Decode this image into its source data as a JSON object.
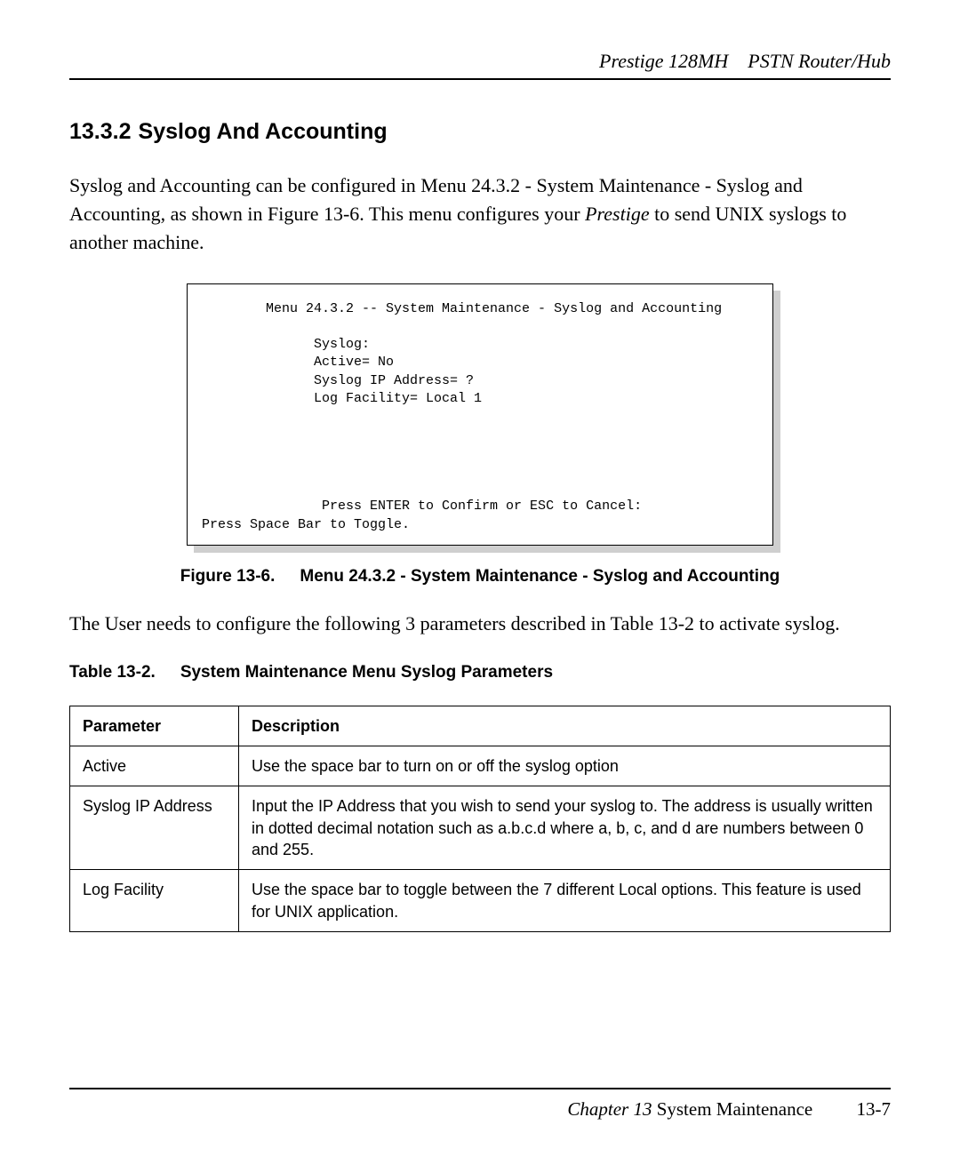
{
  "header": {
    "product": "Prestige 128MH",
    "subtitle": "PSTN Router/Hub"
  },
  "section": {
    "number": "13.3.2",
    "title": "Syslog And Accounting"
  },
  "intro": {
    "p1_prefix": "Syslog and Accounting can be configured in Menu 24.3.2 - System Maintenance - Syslog and Accounting, as shown in Figure 13-6. This menu configures your ",
    "p1_em": "Prestige",
    "p1_suffix": " to send UNIX syslogs to another machine."
  },
  "figure": {
    "box_text": "        Menu 24.3.2 -- System Maintenance - Syslog and Accounting\n\n              Syslog:\n              Active= No\n              Syslog IP Address= ?\n              Log Facility= Local 1\n\n\n\n\n\n               Press ENTER to Confirm or ESC to Cancel:\nPress Space Bar to Toggle.",
    "caption_label": "Figure 13-6.",
    "caption_text": "Menu 24.3.2 - System Maintenance - Syslog and Accounting"
  },
  "mid_paragraph": "The User needs to configure the following 3 parameters described in Table 13-2 to activate syslog.",
  "table": {
    "caption_label": "Table 13-2.",
    "caption_text": "System Maintenance Menu Syslog Parameters",
    "headers": {
      "c1": "Parameter",
      "c2": "Description"
    },
    "rows": [
      {
        "c1": "Active",
        "c2": "Use the space bar to turn on or off the syslog option"
      },
      {
        "c1": "Syslog IP Address",
        "c2": "Input the IP Address that you wish to send your syslog to. The address is usually written in dotted decimal notation such as a.b.c.d where a, b, c, and d are numbers between 0 and 255."
      },
      {
        "c1": "Log Facility",
        "c2": "Use the space bar to toggle between the 7 different Local options. This feature is used for UNIX application."
      }
    ]
  },
  "footer": {
    "chapter_label": "Chapter 13",
    "chapter_name": "System Maintenance",
    "page_number": "13-7"
  }
}
